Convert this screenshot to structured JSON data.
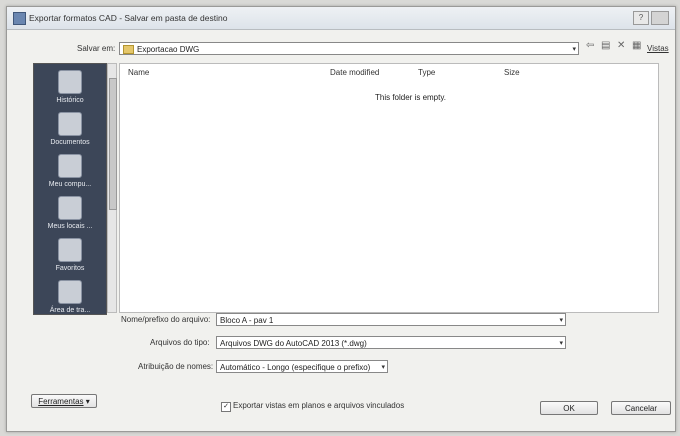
{
  "window": {
    "title": "Exportar formatos CAD - Salvar em pasta de destino",
    "help": "?"
  },
  "save_in": {
    "label": "Salvar em:",
    "value": "Exportacao DWG"
  },
  "toolbar": {
    "views_label": "Vistas"
  },
  "places": [
    {
      "label": "Histórico"
    },
    {
      "label": "Documentos"
    },
    {
      "label": "Meu compu..."
    },
    {
      "label": "Meus locais ..."
    },
    {
      "label": "Favoritos"
    },
    {
      "label": "Área de tra..."
    }
  ],
  "file_list": {
    "columns": [
      "Name",
      "Date modified",
      "Type",
      "Size"
    ],
    "empty_message": "This folder is empty."
  },
  "fields": {
    "filename_label": "Nome/prefixo do arquivo:",
    "filename_value": "Bloco A - pav 1",
    "filetype_label": "Arquivos do tipo:",
    "filetype_value": "Arquivos DWG do AutoCAD 2013  (*.dwg)",
    "naming_label": "Atribuição de nomes:",
    "naming_value": "Automático - Longo (especifique o prefixo)"
  },
  "tools_button": "Ferramentas",
  "export_checkbox": {
    "label": "Exportar vistas em planos e arquivos vinculados",
    "checked": true
  },
  "buttons": {
    "ok": "OK",
    "cancel": "Cancelar"
  }
}
